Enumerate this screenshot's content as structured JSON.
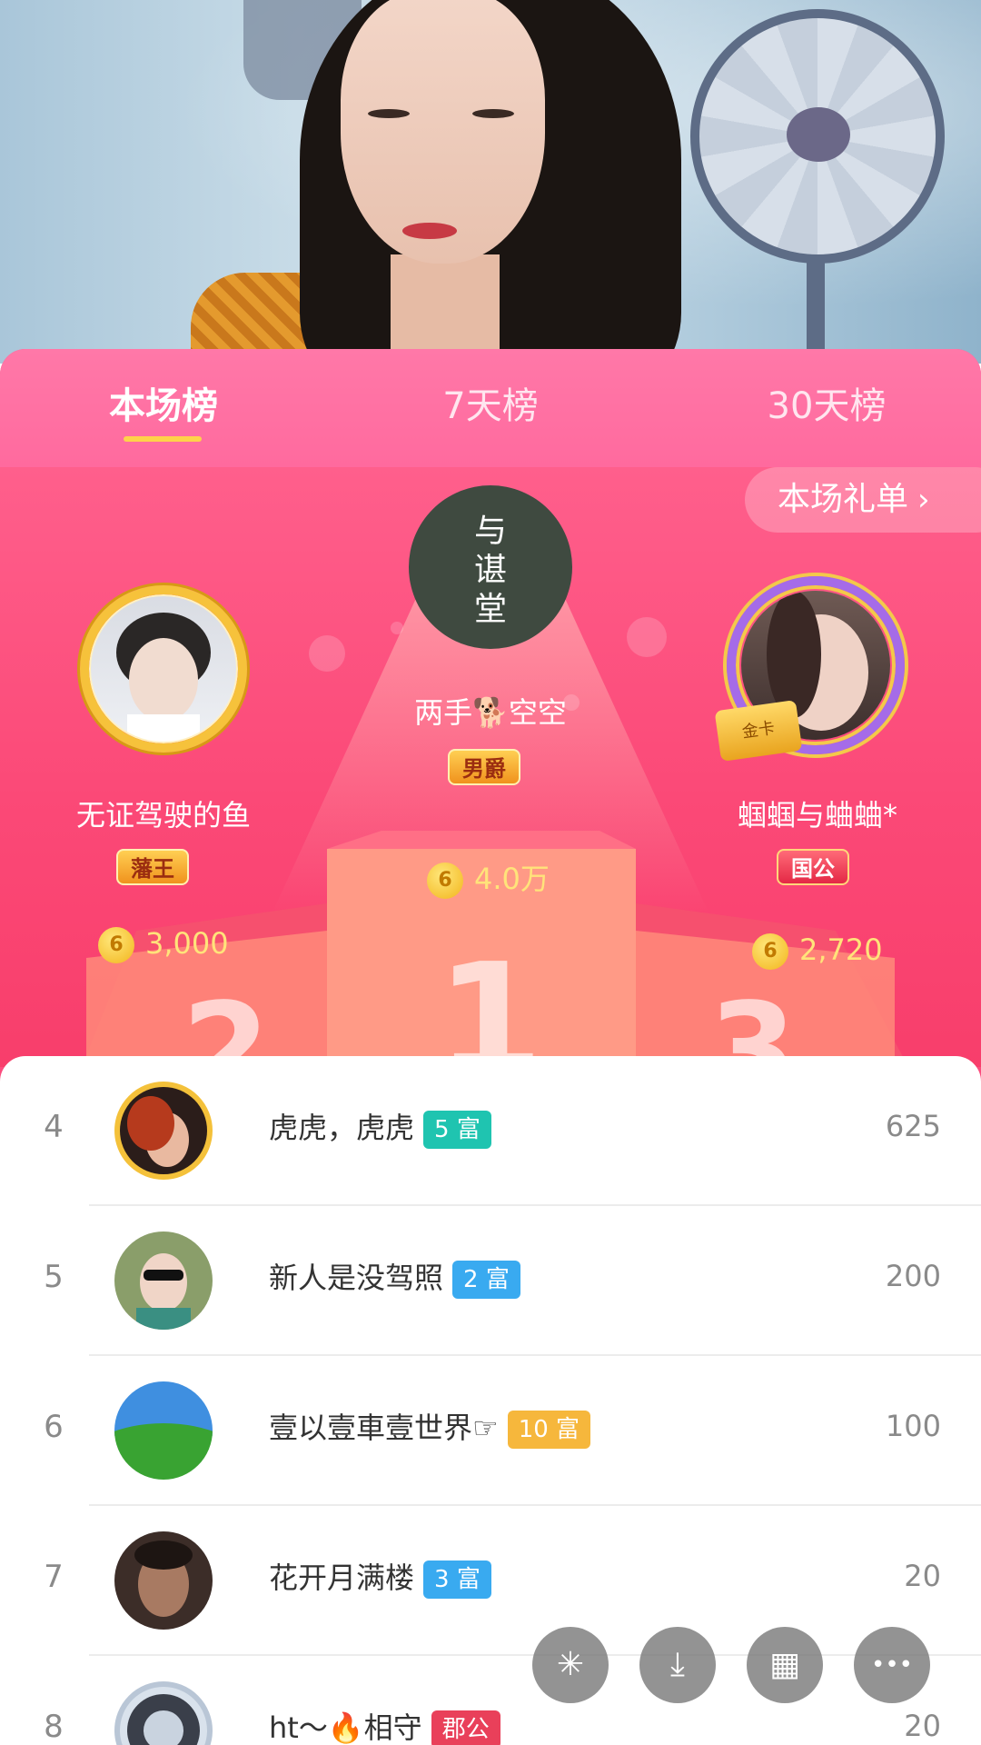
{
  "tabs": [
    {
      "label": "本场榜",
      "active": true
    },
    {
      "label": "7天榜",
      "active": false
    },
    {
      "label": "30天榜",
      "active": false
    }
  ],
  "gift_list_button": {
    "label": "本场礼单",
    "icon": "chevron-right-icon"
  },
  "podium": {
    "first": {
      "rank": "1",
      "name": "两手🐕空空",
      "badge": "男爵",
      "score": "4.0万",
      "coin_icon": "6"
    },
    "second": {
      "rank": "2",
      "name": "无证驾驶的鱼",
      "badge": "藩王",
      "score": "3,000",
      "coin_icon": "6"
    },
    "third": {
      "rank": "3",
      "name": "蝈蝈与蛐蛐*",
      "badge": "国公",
      "score": "2,720",
      "coin_icon": "6"
    }
  },
  "list": [
    {
      "rank": "4",
      "name": "虎虎，虎虎",
      "level": "5 富",
      "level_color": "#1fc4b0",
      "value": "625"
    },
    {
      "rank": "5",
      "name": "新人是没驾照",
      "level": "2 富",
      "level_color": "#39aaf0",
      "value": "200"
    },
    {
      "rank": "6",
      "name": "壹以壹車壹世界☞",
      "level": "10 富",
      "level_color": "#f6b73c",
      "value": "100"
    },
    {
      "rank": "7",
      "name": "花开月满楼",
      "level": "3 富",
      "level_color": "#39aaf0",
      "value": "20"
    },
    {
      "rank": "8",
      "name": "ht～🔥相守",
      "level": "郡公",
      "level_color": "#e9405a",
      "value": "20"
    }
  ],
  "fabs": [
    {
      "name": "share-icon",
      "glyph": "✳"
    },
    {
      "name": "download-icon",
      "glyph": "⤓"
    },
    {
      "name": "grid-icon",
      "glyph": "▦"
    },
    {
      "name": "more-icon",
      "glyph": "•••"
    }
  ]
}
